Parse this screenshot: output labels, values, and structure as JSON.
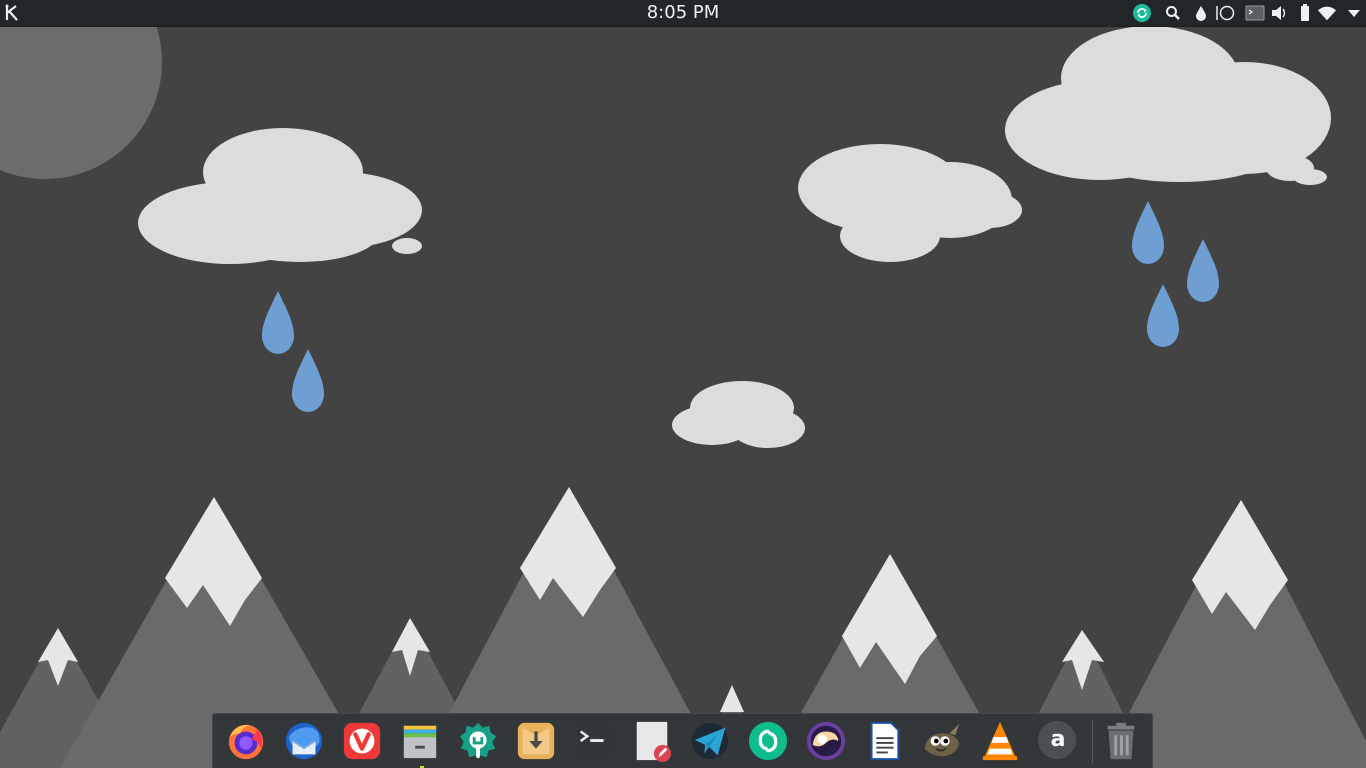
{
  "top_panel": {
    "launcher_icon": "kde-logo-icon",
    "clock": "8:05 PM",
    "tray_icons": [
      "sync-icon",
      "search-icon",
      "ink-drop-icon",
      "circle-icon",
      "console-icon",
      "volume-icon",
      "battery-icon",
      "wifi-icon",
      "expand-arrow-icon"
    ]
  },
  "dock": {
    "apps": [
      {
        "id": "firefox",
        "icon": "firefox-icon"
      },
      {
        "id": "thunderbird",
        "icon": "thunderbird-icon"
      },
      {
        "id": "vivaldi",
        "icon": "vivaldi-icon"
      },
      {
        "id": "file-manager",
        "icon": "file-manager-icon",
        "running": true
      },
      {
        "id": "app-store",
        "icon": "app-store-icon"
      },
      {
        "id": "downloader",
        "icon": "downloader-icon"
      },
      {
        "id": "terminal",
        "icon": "terminal-icon"
      },
      {
        "id": "text-editor",
        "icon": "text-editor-icon"
      },
      {
        "id": "telegram",
        "icon": "telegram-icon"
      },
      {
        "id": "element",
        "icon": "element-icon"
      },
      {
        "id": "cantata",
        "icon": "cantata-icon"
      },
      {
        "id": "libreoffice-writer",
        "icon": "writer-icon"
      },
      {
        "id": "gimp",
        "icon": "gimp-icon"
      },
      {
        "id": "vlc",
        "icon": "vlc-icon"
      },
      {
        "id": "amarok",
        "icon": "amarok-icon",
        "letter": "a"
      },
      {
        "id": "trash",
        "icon": "trash-icon"
      }
    ]
  },
  "colors": {
    "panel_bg": "#232629",
    "dock_bg": "#33373a",
    "wallpaper_bg": "#434343",
    "cloud": "#dcdcdc",
    "raindrop": "#6f9fd2",
    "mountain": "#666666",
    "snow": "#e6e6e6"
  }
}
